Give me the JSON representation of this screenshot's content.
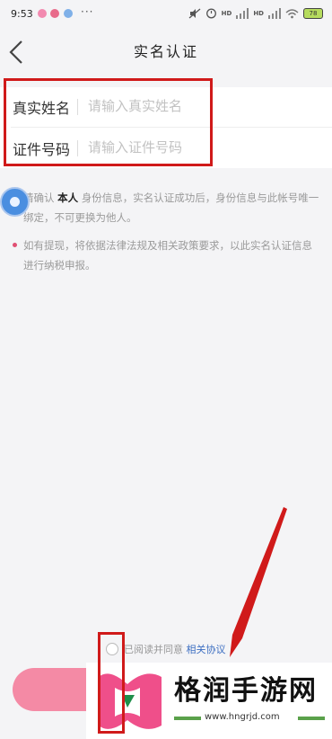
{
  "status_bar": {
    "time": "9:53",
    "more": "···",
    "battery": "78"
  },
  "nav": {
    "title": "实名认证"
  },
  "form": {
    "name_label": "真实姓名",
    "name_placeholder": "请输入真实姓名",
    "id_label": "证件号码",
    "id_placeholder": "请输入证件号码"
  },
  "notices": {
    "n1_prefix": "请确认",
    "n1_bold": "本人",
    "n1_suffix": "身份信息，实名认证成功后，身份信息与此帐号唯一绑定，不可更换为他人。",
    "n2": "如有提现，将依据法律法规及相关政策要求，以此实名认证信息进行纳税申报。"
  },
  "agreement": {
    "text": "已阅读并同意",
    "link": "相关协议"
  },
  "watermark": {
    "text": "格润手游网",
    "url": "www.hngrjd.com"
  },
  "colors": {
    "accent_pink": "#f48aa5",
    "annotation_red": "#d01a1a",
    "link_blue": "#3d6fc2"
  }
}
